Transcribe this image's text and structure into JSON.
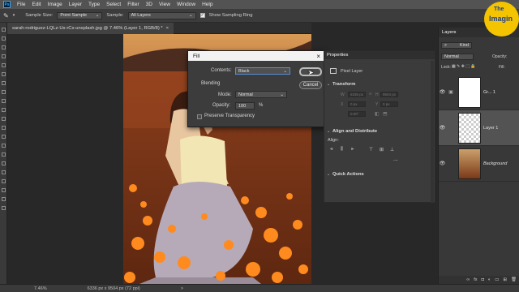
{
  "menubar": {
    "items": [
      "File",
      "Edit",
      "Image",
      "Layer",
      "Type",
      "Select",
      "Filter",
      "3D",
      "View",
      "Window",
      "Help"
    ],
    "app_icon": "Ps"
  },
  "options": {
    "sample_size_label": "Sample Size:",
    "sample_size_value": "Point Sample",
    "sample_label": "Sample:",
    "sample_value": "All Layers",
    "show_ring_label": "Show Sampling Ring"
  },
  "document": {
    "tab_title": "sarah-rodriguez-LQLz-Us-rCs-unsplash.jpg @ 7.46% (Layer 1, RGB/8) *",
    "tab_close": "×"
  },
  "status": {
    "zoom": "7.46%",
    "doc_info": "6336 px x 9504 px (72 ppi)",
    "arrow": ">"
  },
  "fill": {
    "title": "Fill",
    "close": "×",
    "contents_label": "Contents:",
    "contents_value": "Black",
    "ok_label": "OK",
    "cancel_label": "Cancel",
    "blending_label": "Blending",
    "mode_label": "Mode:",
    "mode_value": "Normal",
    "opacity_label": "Opacity:",
    "opacity_value": "100",
    "opacity_unit": "%",
    "preserve_label": "Preserve Transparency"
  },
  "properties": {
    "tab": "Properties",
    "layer_type": "Pixel Layer",
    "transform_label": "Transform",
    "w_label": "W",
    "h_label": "H",
    "x_label": "X",
    "y_label": "Y",
    "w_value": "6336 px",
    "h_value": "9504 px",
    "x_value": "0 px",
    "y_value": "0 px",
    "angle_value": "0.00°",
    "align_label": "Align and Distribute",
    "align_sub": "Align:",
    "more": "...",
    "quick_label": "Quick Actions"
  },
  "layers": {
    "tab": "Layers",
    "kind_label": "Kind",
    "blend_value": "Normal",
    "opacity_label": "Opacity:",
    "opacity_value": "100%",
    "lock_label": "Lock:",
    "fill_label": "Fill:",
    "fill_value": "100%",
    "items": [
      {
        "name": "Gr... 1",
        "thumb": "white"
      },
      {
        "name": "Layer 1",
        "thumb": "transparent"
      },
      {
        "name": "Background",
        "thumb": "photo"
      }
    ]
  },
  "logo": {
    "line1": "The",
    "line2": "Imagin"
  },
  "colors": {
    "accent": "#31a8ff",
    "panel": "#383838",
    "photo_tone": "#b4612e"
  }
}
